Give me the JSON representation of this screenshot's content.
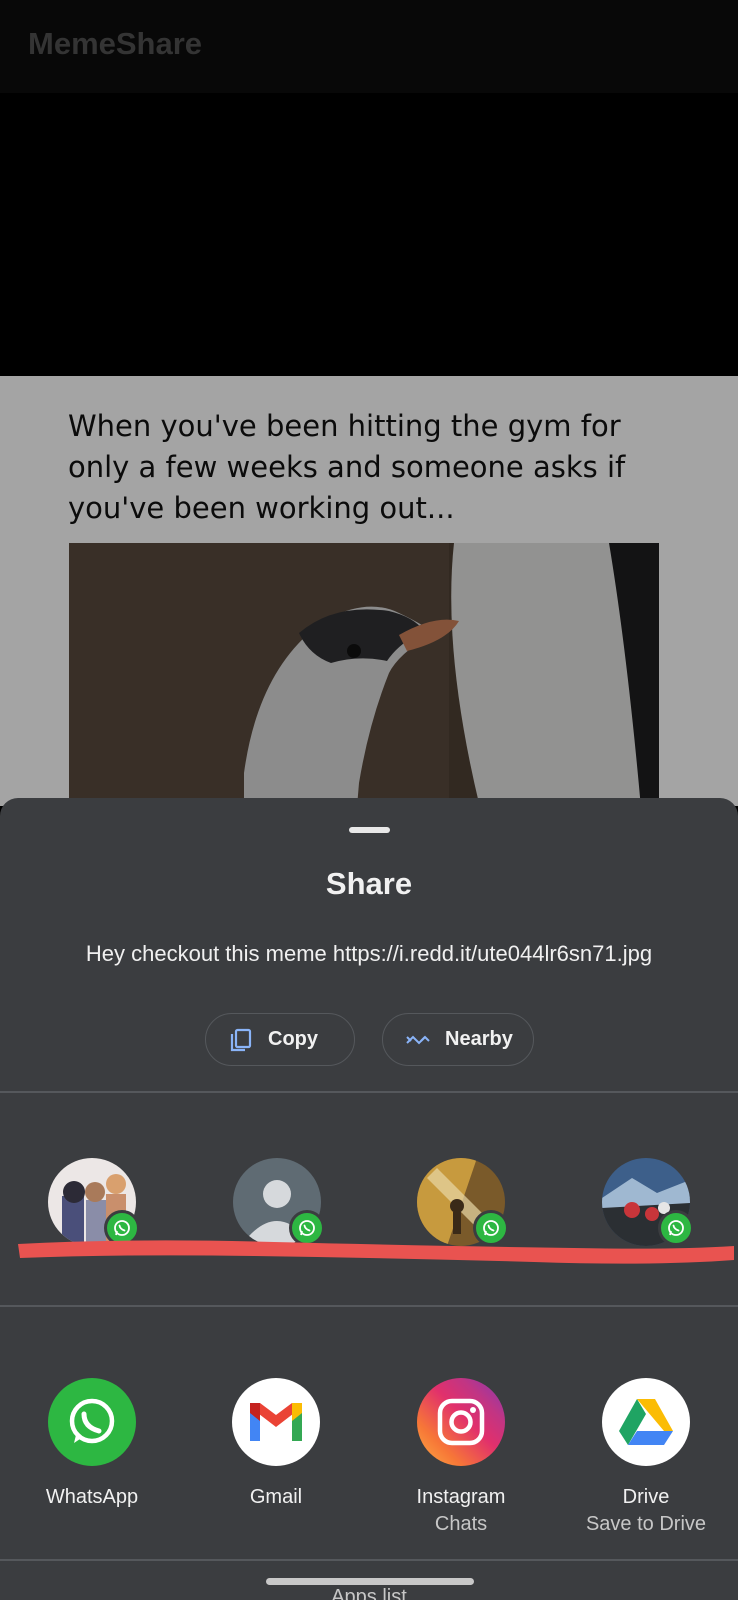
{
  "app": {
    "title": "MemeShare"
  },
  "meme": {
    "caption": "When you've been hitting the gym for only a few weeks and someone asks if you've been working out..."
  },
  "share_sheet": {
    "title": "Share",
    "text": "Hey checkout this meme https://i.redd.it/ute044lr6sn71.jpg",
    "actions": [
      {
        "label": "Copy",
        "icon": "copy-icon"
      },
      {
        "label": "Nearby",
        "icon": "nearby-icon"
      }
    ],
    "direct_targets": [
      {
        "icon": "whatsapp-badge-icon"
      },
      {
        "icon": "whatsapp-badge-icon"
      },
      {
        "icon": "whatsapp-badge-icon"
      },
      {
        "icon": "whatsapp-badge-icon"
      }
    ],
    "apps": [
      {
        "label": "WhatsApp",
        "sublabel": "",
        "icon": "whatsapp-icon"
      },
      {
        "label": "Gmail",
        "sublabel": "",
        "icon": "gmail-icon"
      },
      {
        "label": "Instagram",
        "sublabel": "Chats",
        "icon": "instagram-icon"
      },
      {
        "label": "Drive",
        "sublabel": "Save to Drive",
        "icon": "drive-icon"
      }
    ],
    "apps_list_label": "Apps list"
  },
  "colors": {
    "sheet_background": "#3b3d40",
    "whatsapp_green": "#2db742",
    "redaction_red": "#e95350"
  }
}
